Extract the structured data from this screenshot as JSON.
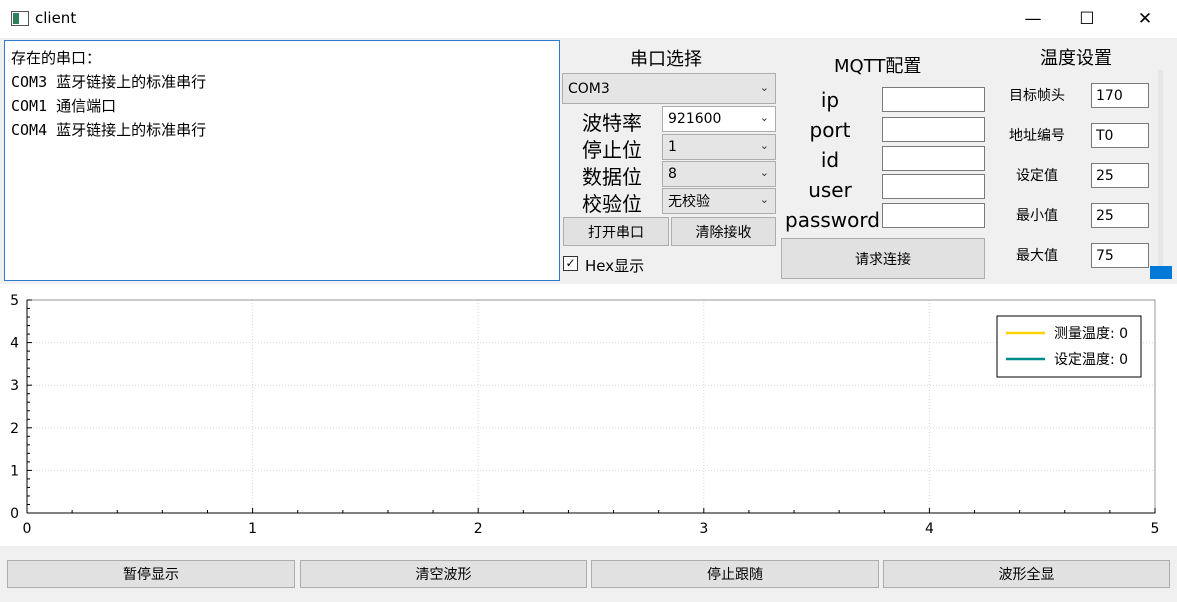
{
  "window": {
    "title": "client",
    "controls": {
      "minimize": "—",
      "maximize": "☐",
      "close": "✕"
    }
  },
  "port_list": {
    "text": "存在的串口：\nCOM3 蓝牙链接上的标准串行\nCOM1 通信端口\nCOM4 蓝牙链接上的标准串行"
  },
  "serial": {
    "title": "串口选择",
    "port_value": "COM3",
    "baud_label": "波特率",
    "baud_value": "921600",
    "stop_label": "停止位",
    "stop_value": "1",
    "data_label": "数据位",
    "data_value": "8",
    "parity_label": "校验位",
    "parity_value": "无校验",
    "open_button": "打开串口",
    "clear_button": "清除接收",
    "hex_label": "Hex显示",
    "hex_checked": true
  },
  "mqtt": {
    "title": "MQTT配置",
    "ip_label": "ip",
    "ip_value": "",
    "port_label": "port",
    "port_value": "",
    "id_label": "id",
    "id_value": "",
    "user_label": "user",
    "user_value": "",
    "password_label": "password",
    "password_value": "",
    "connect_button": "请求连接"
  },
  "temperature": {
    "title": "温度设置",
    "header_label": "目标帧头",
    "header_value": "170",
    "address_label": "地址编号",
    "address_value": "T0",
    "setpoint_label": "设定值",
    "setpoint_value": "25",
    "min_label": "最小值",
    "min_value": "25",
    "max_label": "最大值",
    "max_value": "75"
  },
  "chart_data": {
    "type": "line",
    "xlim": [
      0,
      5
    ],
    "ylim": [
      0,
      5
    ],
    "x_ticks": [
      "0",
      "1",
      "2",
      "3",
      "4",
      "5"
    ],
    "y_ticks": [
      "0",
      "1",
      "2",
      "3",
      "4",
      "5"
    ],
    "grid": true,
    "legend_position": "top-right",
    "series": [
      {
        "name": "测量温度: 0",
        "color": "#ffd200",
        "values": []
      },
      {
        "name": "设定温度: 0",
        "color": "#008b8b",
        "values": []
      }
    ]
  },
  "bottom": {
    "pause_button": "暂停显示",
    "clear_wave_button": "清空波形",
    "stop_follow_button": "停止跟随",
    "full_view_button": "波形全显"
  },
  "icons": {
    "checkbox": "check-icon",
    "dropdown": "chevron-down-icon"
  }
}
